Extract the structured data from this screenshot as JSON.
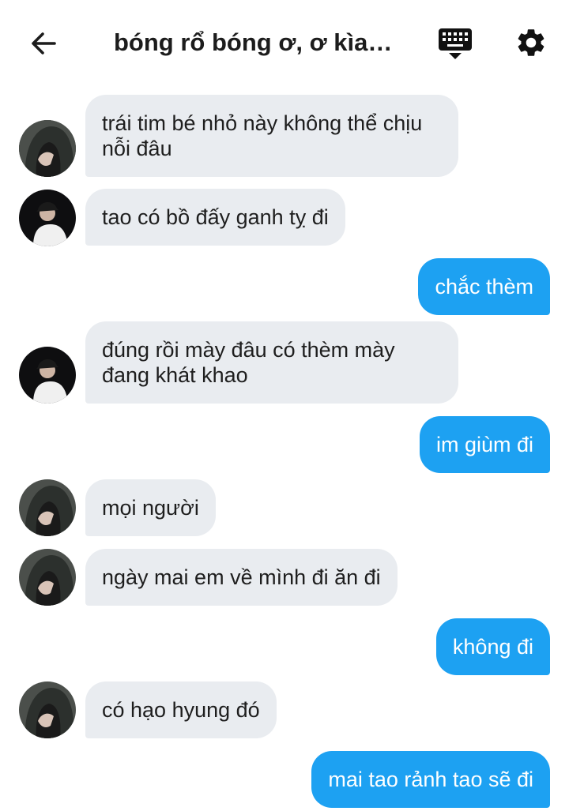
{
  "header": {
    "back_icon": "arrow-left-icon",
    "title": "bóng rổ bóng ơ, ơ kìa b...",
    "keyboard_icon": "keyboard-icon",
    "settings_icon": "gear-icon"
  },
  "colors": {
    "outgoing_bubble": "#1da1f2",
    "incoming_bubble": "#e9ecf0"
  },
  "messages": [
    {
      "sender": "in",
      "avatar": "avatar-hood",
      "text": "trái tim bé nhỏ này không thể chịu nỗi đâu"
    },
    {
      "sender": "in",
      "avatar": "avatar-cap",
      "text": "tao có bồ đấy ganh tỵ đi"
    },
    {
      "sender": "out",
      "text": "chắc thèm"
    },
    {
      "sender": "in",
      "avatar": "avatar-cap",
      "text": "đúng rồi mày đâu có thèm mày đang khát khao"
    },
    {
      "sender": "out",
      "text": "im giùm đi"
    },
    {
      "sender": "in",
      "avatar": "avatar-hood",
      "text": "mọi người"
    },
    {
      "sender": "in",
      "avatar": "avatar-hood",
      "text": "ngày mai em về mình đi ăn đi"
    },
    {
      "sender": "out",
      "text": "không đi"
    },
    {
      "sender": "in",
      "avatar": "avatar-hood",
      "text": "có hạo hyung đó"
    },
    {
      "sender": "out",
      "text": "mai tao rảnh tao sẽ đi"
    }
  ]
}
